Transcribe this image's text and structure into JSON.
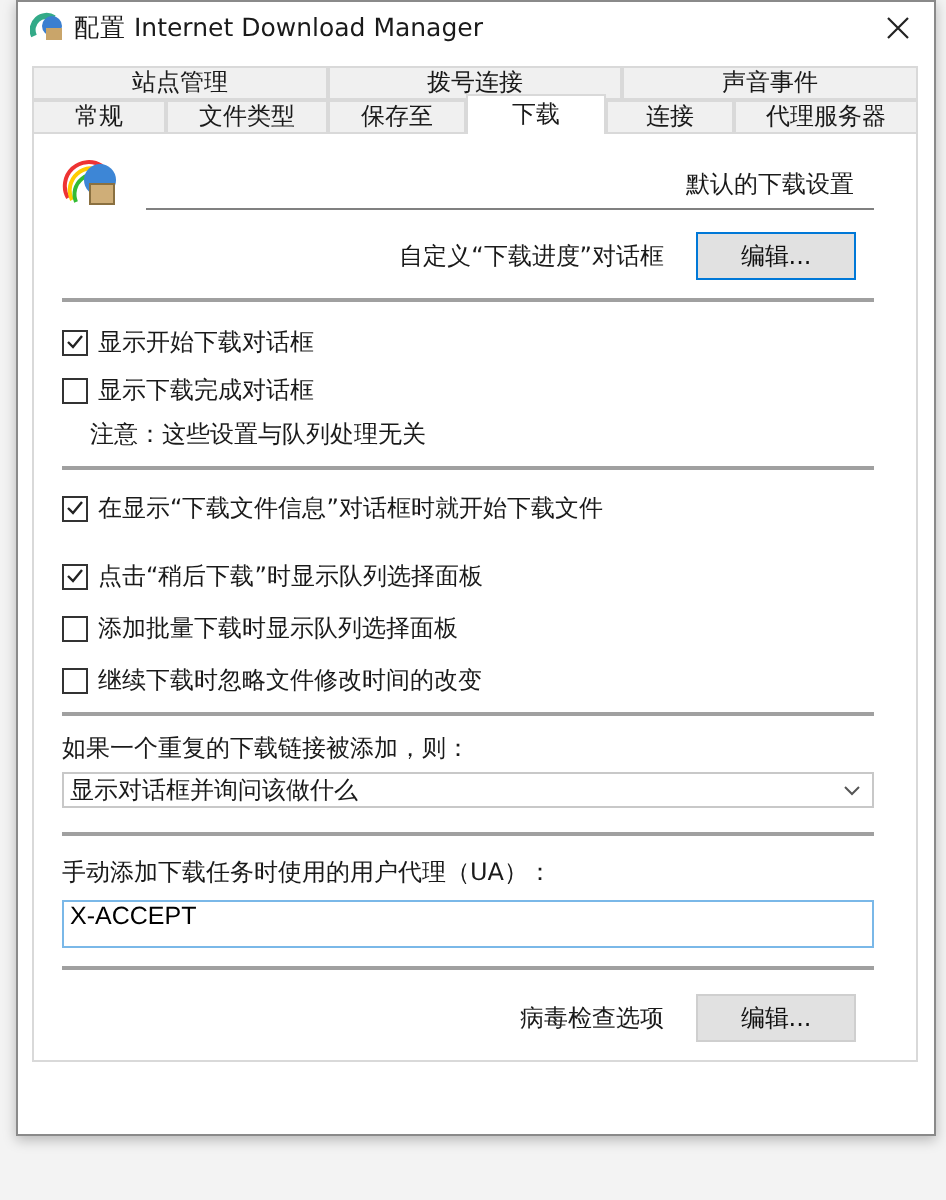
{
  "window": {
    "title": "配置 Internet Download Manager"
  },
  "tab_rows": [
    [
      {
        "label": "站点管理",
        "selected": false
      },
      {
        "label": "拨号连接",
        "selected": false
      },
      {
        "label": "声音事件",
        "selected": false
      }
    ],
    [
      {
        "label": "常规",
        "selected": false
      },
      {
        "label": "文件类型",
        "selected": false
      },
      {
        "label": "保存至",
        "selected": false
      },
      {
        "label": "下载",
        "selected": true
      },
      {
        "label": "连接",
        "selected": false
      },
      {
        "label": "代理服务器",
        "selected": false
      }
    ]
  ],
  "header": {
    "title": "默认的下载设置"
  },
  "progress_dialog": {
    "label": "自定义“下载进度”对话框",
    "button": "编辑..."
  },
  "dialog_options": [
    {
      "label": "显示开始下载对话框",
      "checked": true
    },
    {
      "label": "显示下载完成对话框",
      "checked": false
    }
  ],
  "note": "注意：这些设置与队列处理无关",
  "start_option": {
    "label": "在显示“下载文件信息”对话框时就开始下载文件",
    "checked": true
  },
  "queue_options": [
    {
      "label": "点击“稍后下载”时显示队列选择面板",
      "checked": true
    },
    {
      "label": "添加批量下载时显示队列选择面板",
      "checked": false
    },
    {
      "label": "继续下载时忽略文件修改时间的改变",
      "checked": false
    }
  ],
  "duplicate": {
    "label": "如果一个重复的下载链接被添加，则：",
    "value": "显示对话框并询问该做什么"
  },
  "user_agent": {
    "label": "手动添加下载任务时使用的用户代理（UA）：",
    "value": "X-ACCEPT"
  },
  "virus": {
    "label": "病毒检查选项",
    "button": "编辑..."
  }
}
